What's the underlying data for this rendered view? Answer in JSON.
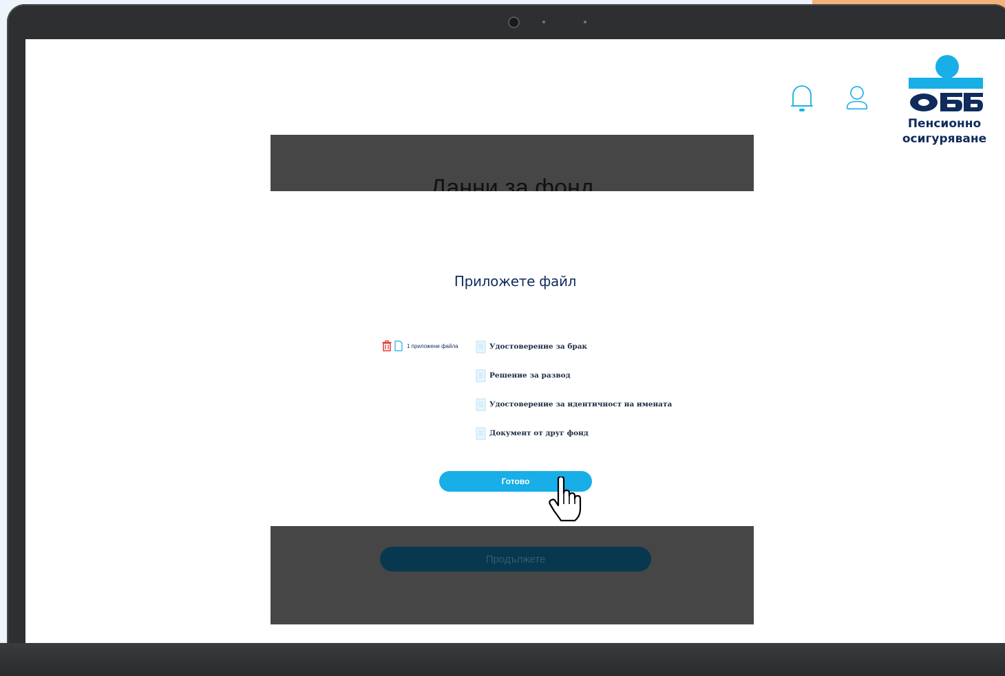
{
  "header": {
    "icons": [
      "bell-icon",
      "user-icon"
    ]
  },
  "logo": {
    "mark_text": "ОББ",
    "line1": "Пенсионно",
    "line2": "осигуряване"
  },
  "background_page": {
    "title": "Данни за фонд",
    "continue_label": "Продължете"
  },
  "modal": {
    "title": "Приложете файл",
    "attached_count_label": "1 приложени файла",
    "documents": [
      "Удостоверение за брак",
      "Решение за развод",
      "Удостоверение за идентичност на имената",
      "Документ от друг фонд"
    ],
    "done_label": "Готово"
  },
  "colors": {
    "accent": "#18aee7",
    "brand_navy": "#0f2c5c",
    "delete_red": "#e32b2b"
  }
}
